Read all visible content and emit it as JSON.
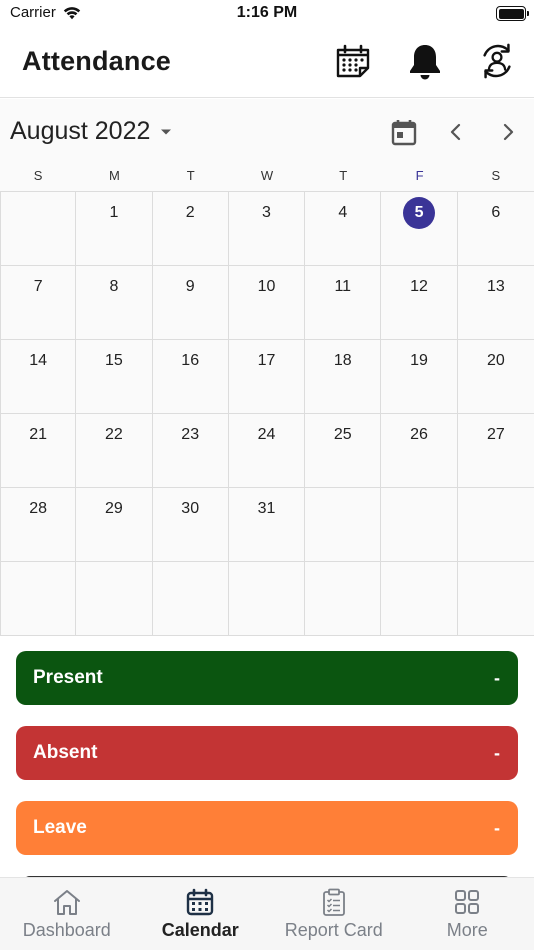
{
  "status_bar": {
    "carrier": "Carrier",
    "time": "1:16 PM"
  },
  "header": {
    "title": "Attendance"
  },
  "calendar": {
    "month_label": "August 2022",
    "weekdays": [
      "S",
      "M",
      "T",
      "W",
      "T",
      "F",
      "S"
    ],
    "highlight_color": "#3a3497",
    "weeks": [
      [
        "",
        "1",
        "2",
        "3",
        "4",
        "5",
        "6"
      ],
      [
        "7",
        "8",
        "9",
        "10",
        "11",
        "12",
        "13"
      ],
      [
        "14",
        "15",
        "16",
        "17",
        "18",
        "19",
        "20"
      ],
      [
        "21",
        "22",
        "23",
        "24",
        "25",
        "26",
        "27"
      ],
      [
        "28",
        "29",
        "30",
        "31",
        "",
        "",
        ""
      ],
      [
        "",
        "",
        "",
        "",
        "",
        "",
        ""
      ]
    ],
    "today": "5"
  },
  "legend": [
    {
      "label": "Present",
      "value": "-",
      "color": "#0b5510"
    },
    {
      "label": "Absent",
      "value": "-",
      "color": "#c33434"
    },
    {
      "label": "Leave",
      "value": "-",
      "color": "#ff7f37"
    }
  ],
  "tabs": [
    {
      "label": "Dashboard",
      "icon": "home-icon",
      "active": false
    },
    {
      "label": "Calendar",
      "icon": "calendar-icon",
      "active": true
    },
    {
      "label": "Report Card",
      "icon": "clipboard-icon",
      "active": false
    },
    {
      "label": "More",
      "icon": "grid-icon",
      "active": false
    }
  ]
}
